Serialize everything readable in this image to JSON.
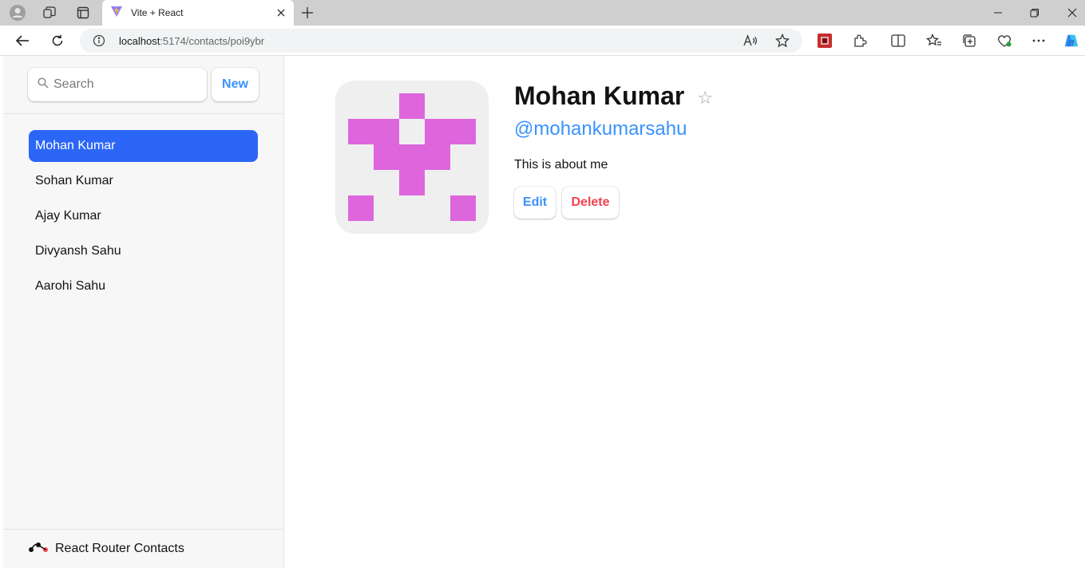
{
  "browser": {
    "tab_title": "Vite + React",
    "url_host": "localhost",
    "url_rest": ":5174/contacts/poi9ybr"
  },
  "sidebar": {
    "search_placeholder": "Search",
    "new_label": "New",
    "contacts": [
      {
        "name": "Mohan Kumar",
        "active": true
      },
      {
        "name": "Sohan Kumar",
        "active": false
      },
      {
        "name": "Ajay Kumar",
        "active": false
      },
      {
        "name": "Divyansh Sahu",
        "active": false
      },
      {
        "name": "Aarohi Sahu",
        "active": false
      }
    ],
    "brand": "React Router Contacts"
  },
  "contact": {
    "name": "Mohan Kumar",
    "favorite_icon": "☆",
    "handle": "@mohankumarsahu",
    "notes": "This is about me",
    "edit_label": "Edit",
    "delete_label": "Delete"
  },
  "colors": {
    "accent": "#3992ff",
    "active_bg": "#2b66f6",
    "danger": "#f44250",
    "avatar_fill": "#dd66dd"
  }
}
